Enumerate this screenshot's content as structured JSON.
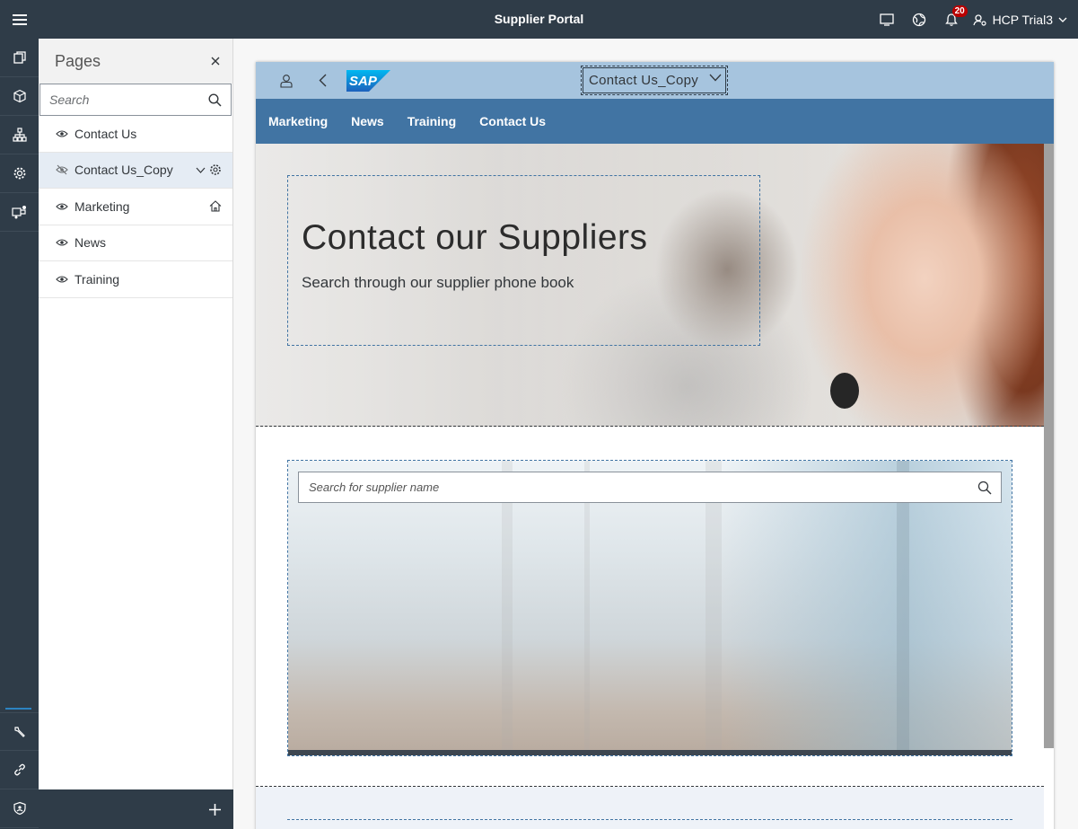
{
  "shell": {
    "title": "Supplier Portal",
    "notification_count": "20",
    "user_name": "HCP Trial3"
  },
  "rail": {
    "items": [
      "pages-icon",
      "cube-icon",
      "hierarchy-icon",
      "settings-icon",
      "services-icon"
    ],
    "bottom_items": [
      "wrench-icon",
      "link-icon",
      "shield-icon"
    ]
  },
  "pages_panel": {
    "title": "Pages",
    "search_placeholder": "Search",
    "items": [
      {
        "label": "Contact Us",
        "selected": false
      },
      {
        "label": "Contact Us_Copy",
        "selected": true,
        "hidden": true
      },
      {
        "label": "Marketing",
        "home": true
      },
      {
        "label": "News"
      },
      {
        "label": "Training"
      }
    ]
  },
  "site": {
    "logo_text": "SAP",
    "page_selector": "Contact Us_Copy",
    "nav": [
      "Marketing",
      "News",
      "Training",
      "Contact Us"
    ],
    "hero": {
      "title": "Contact our Suppliers",
      "subtitle": "Search through our supplier phone book"
    },
    "supplier_search_placeholder": "Search for supplier name"
  },
  "colors": {
    "shell": "#2f3c48",
    "site_topbar": "#a6c4de",
    "site_nav": "#4174a3",
    "badge": "#bb0000"
  }
}
